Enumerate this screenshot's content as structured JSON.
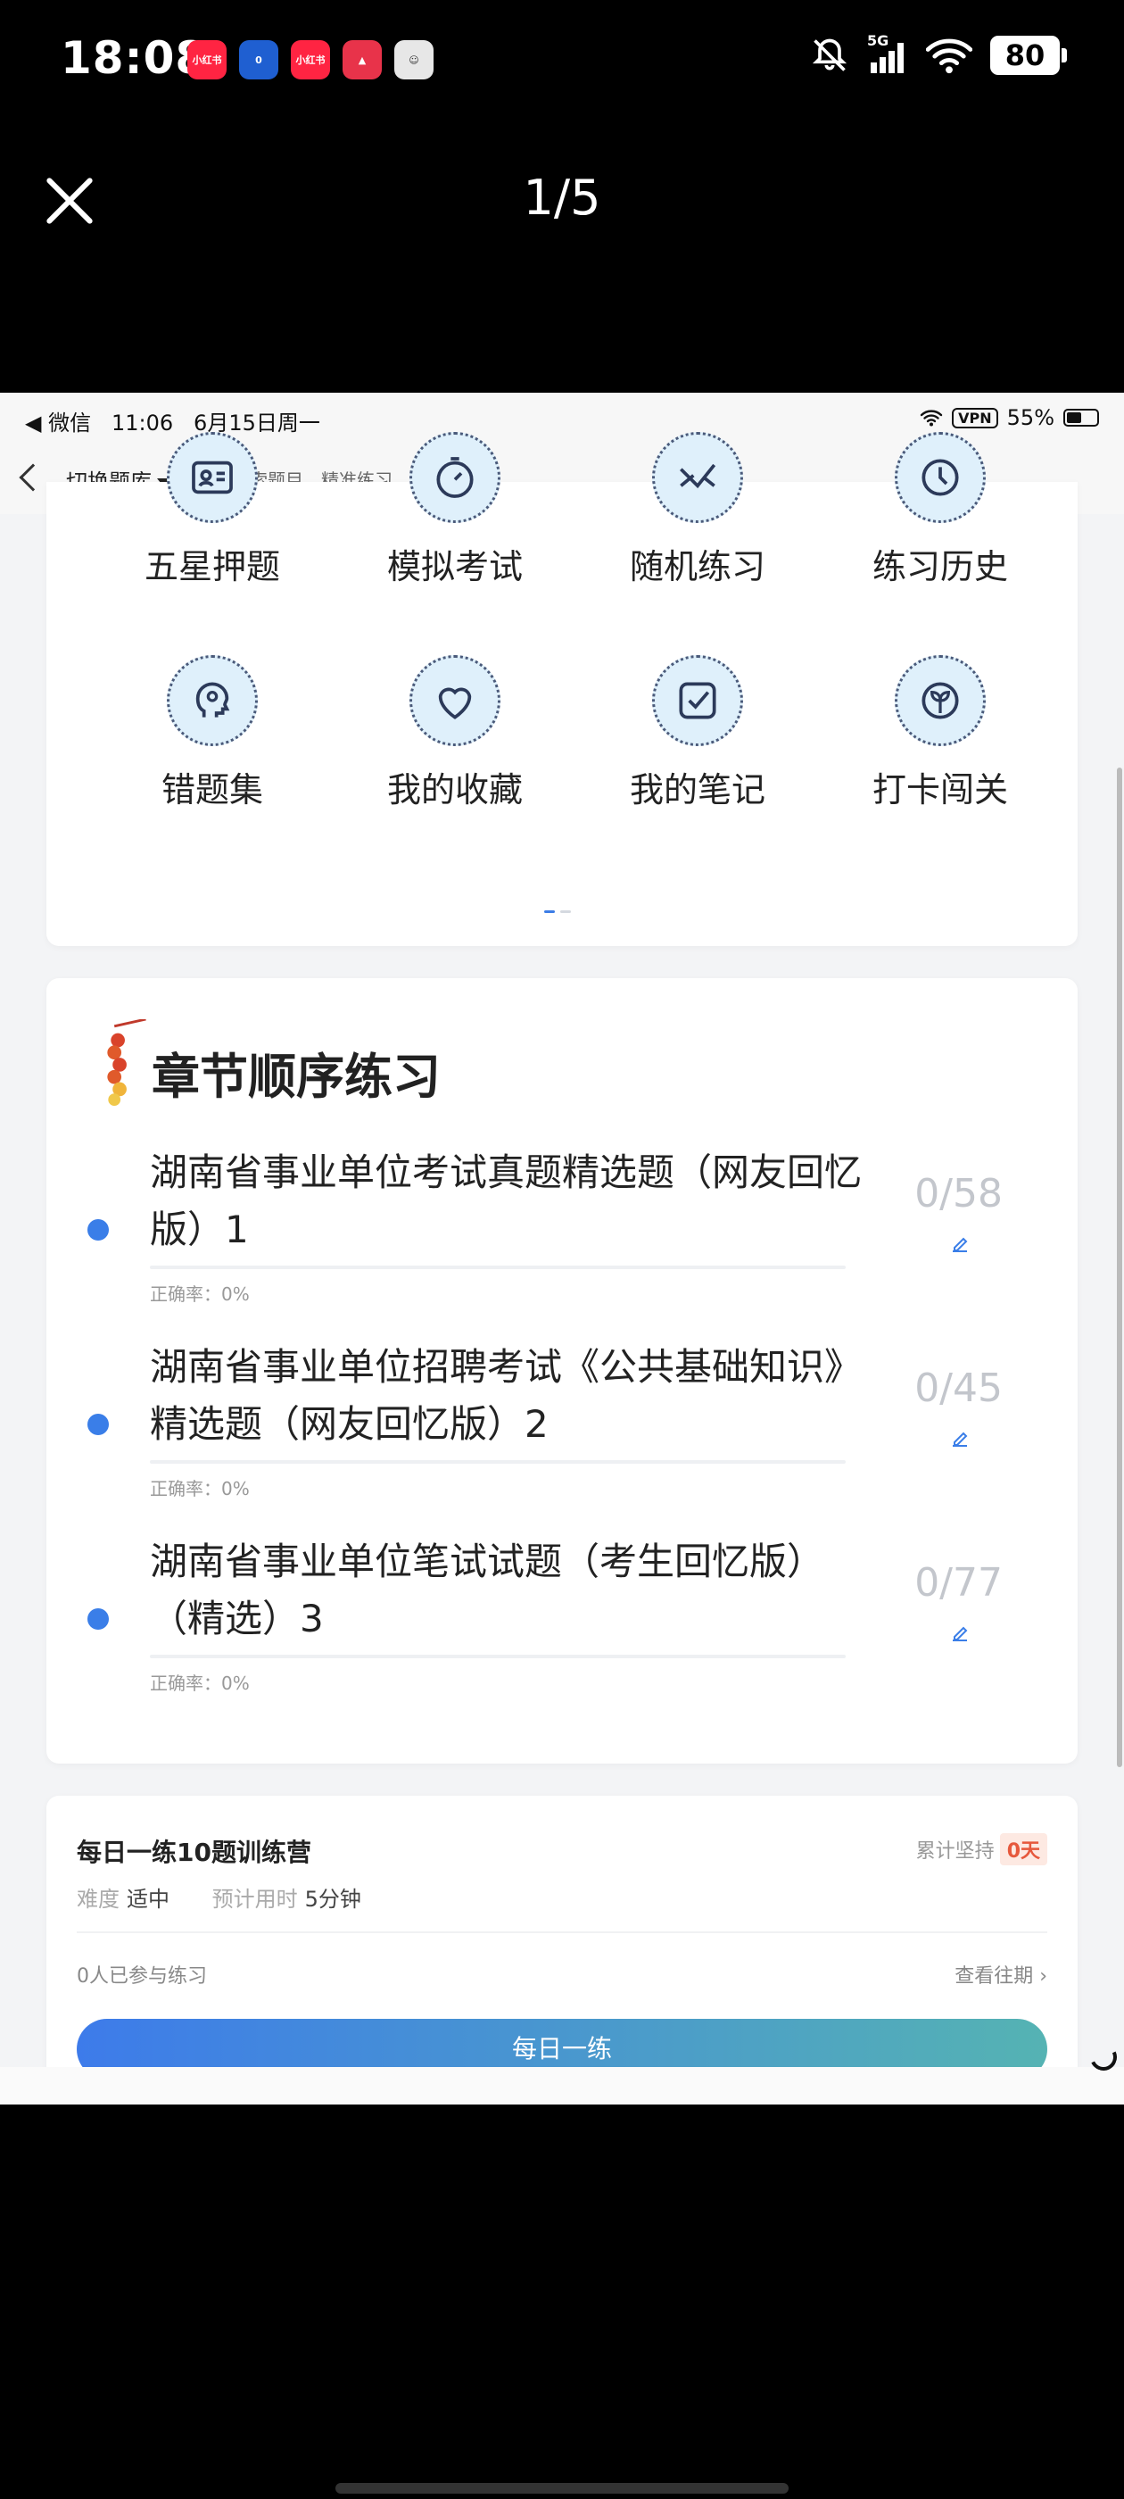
{
  "os": {
    "time": "18:08",
    "network": "5G",
    "battery": "80",
    "app_icons": [
      {
        "label": "小红书",
        "color": "#ff2442"
      },
      {
        "label": "0",
        "color": "#1f5fd1"
      },
      {
        "label": "小红书",
        "color": "#ff2442"
      },
      {
        "label": "▲",
        "color": "#e8334a"
      },
      {
        "label": "☺",
        "color": "#e7e7e7"
      }
    ]
  },
  "viewer": {
    "counter": "1/5"
  },
  "inner_status": {
    "carrier": "◀ 微信",
    "time": "11:06",
    "date": "6月15日周一",
    "vpn": "VPN",
    "battery": "55%"
  },
  "nav": {
    "switch_label": "切换题库",
    "search_placeholder": "搜索题目，精准练习"
  },
  "grid": [
    {
      "label": "五星押题",
      "icon": "id-card-icon"
    },
    {
      "label": "模拟考试",
      "icon": "stopwatch-icon"
    },
    {
      "label": "随机练习",
      "icon": "random-icon"
    },
    {
      "label": "练习历史",
      "icon": "history-icon"
    },
    {
      "label": "错题集",
      "icon": "head-icon"
    },
    {
      "label": "我的收藏",
      "icon": "heart-icon"
    },
    {
      "label": "我的笔记",
      "icon": "note-check-icon"
    },
    {
      "label": "打卡闯关",
      "icon": "sprout-icon"
    }
  ],
  "chapter": {
    "title": "章节顺序练习",
    "items": [
      {
        "name": "湖南省事业单位考试真题精选题（网友回忆版）1",
        "count": "0/58",
        "accuracy": "正确率：0%"
      },
      {
        "name": "湖南省事业单位招聘考试《公共基础知识》精选题（网友回忆版）2",
        "count": "0/45",
        "accuracy": "正确率：0%"
      },
      {
        "name": "湖南省事业单位笔试试题（考生回忆版）（精选）3",
        "count": "0/77",
        "accuracy": "正确率：0%"
      }
    ]
  },
  "daily": {
    "title": "每日一练10题训练营",
    "streak_label": "累计坚持",
    "streak_value": "0天",
    "difficulty_label": "难度",
    "difficulty_value": "适中",
    "time_label": "预计用时",
    "time_value": "5分钟",
    "participants": "0人已参与练习",
    "past_link": "查看往期 ›",
    "button": "每日一练"
  },
  "colors": {
    "accent": "#3a7ee8",
    "streak": "#e6583c"
  }
}
